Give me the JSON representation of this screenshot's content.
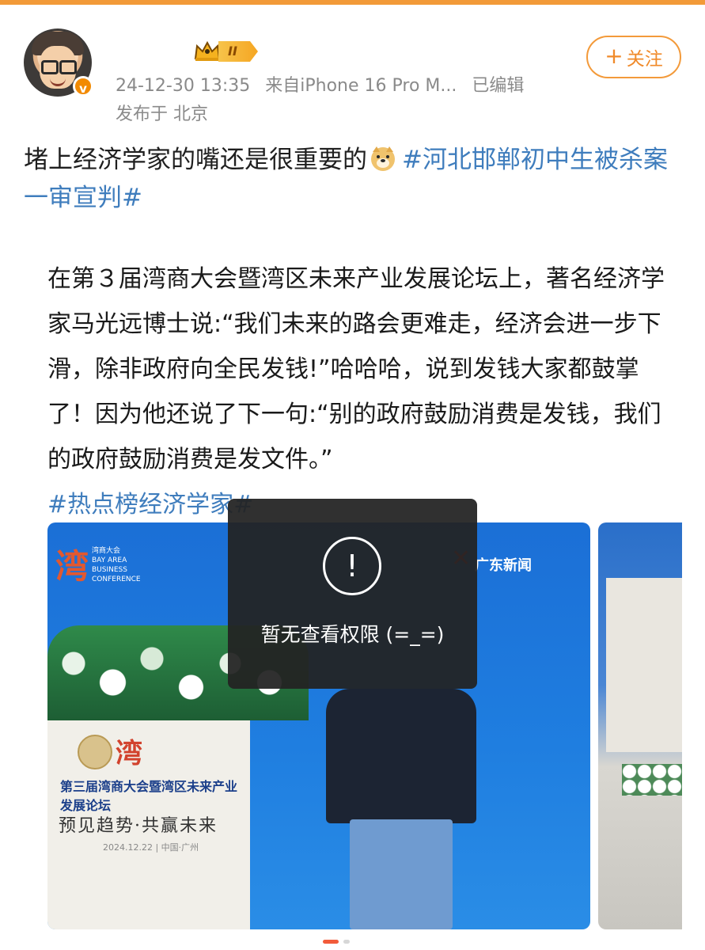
{
  "header": {
    "level_label": "II",
    "timestamp": "24-12-30 13:35",
    "source": "来自iPhone 16 Pro M...",
    "edited": "已编辑",
    "location": "发布于 北京",
    "follow_label": "关注",
    "verified_mark": "v"
  },
  "post": {
    "text": "堵上经济学家的嘴还是很重要的",
    "hashtag": "#河北邯郸初中生被杀案一审宣判#"
  },
  "repost_image": {
    "paragraph": "在第３届湾商大会暨湾区未来产业发展论坛上，著名经济学家马光远博士说:“我们未来的路会更难走，经济会进一步下滑，除非政府向全民发钱!”哈哈哈，说到发钱大家都鼓掌了！因为他还说了下一句:“别的政府鼓励消费是发钱，我们的政府鼓励消费是发文件。”",
    "hashtag": "#热点榜经济学家#",
    "photo": {
      "logo_caption": "湾商大会",
      "logo_sub": "BAY AREA BUSINESS CONFERENCE",
      "news_brand": "广东新闻",
      "podium_title": "第三届湾商大会暨湾区未来产业发展论坛",
      "podium_slogan": "预见趋势·共赢未来",
      "podium_date": "2024.12.22 | 中国·广州"
    }
  },
  "toast": {
    "icon_glyph": "!",
    "message": "暂无查看权限 (=_=)"
  },
  "colors": {
    "accent": "#f39a3a",
    "link": "#3f7dbd",
    "meta": "#8a8a8a"
  }
}
